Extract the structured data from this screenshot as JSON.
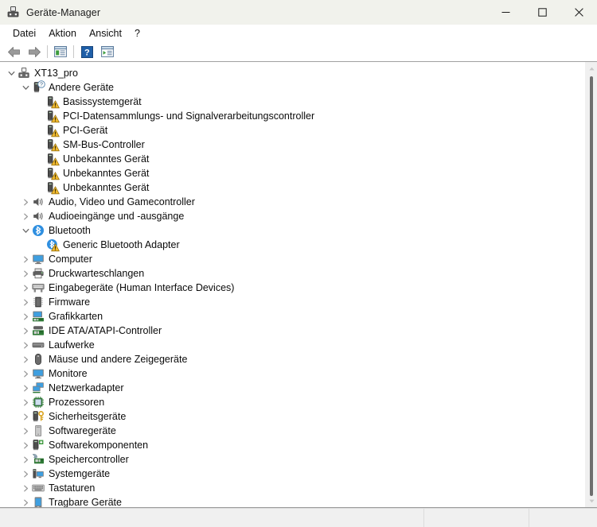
{
  "window": {
    "title": "Geräte-Manager",
    "icon": "device-manager-icon",
    "minimize_label": "—",
    "maximize_label": "□",
    "close_label": "✕"
  },
  "menubar": {
    "items": [
      {
        "label": "Datei",
        "name": "menu-datei"
      },
      {
        "label": "Aktion",
        "name": "menu-aktion"
      },
      {
        "label": "Ansicht",
        "name": "menu-ansicht"
      },
      {
        "label": "?",
        "name": "menu-hilfe"
      }
    ]
  },
  "toolbar": {
    "items": [
      {
        "icon": "back-arrow-icon",
        "tooltip": "Zurück"
      },
      {
        "icon": "forward-arrow-icon",
        "tooltip": "Vorwärts"
      },
      {
        "icon": "properties-icon",
        "tooltip": "Eigenschaften"
      },
      {
        "icon": "help-icon",
        "tooltip": "Hilfe"
      },
      {
        "icon": "scan-hardware-icon",
        "tooltip": "Nach geänderter Hardware suchen"
      }
    ]
  },
  "tree": {
    "rows": [
      {
        "depth": 0,
        "state": "expanded",
        "icon": "computer-root-icon",
        "label": "XT13_pro"
      },
      {
        "depth": 1,
        "state": "expanded",
        "icon": "unknown-device-group-icon",
        "label": "Andere Geräte"
      },
      {
        "depth": 2,
        "state": "leaf",
        "icon": "unknown-device-warning-icon",
        "label": "Basissystemgerät"
      },
      {
        "depth": 2,
        "state": "leaf",
        "icon": "unknown-device-warning-icon",
        "label": "PCI-Datensammlungs- und Signalverarbeitungscontroller"
      },
      {
        "depth": 2,
        "state": "leaf",
        "icon": "unknown-device-warning-icon",
        "label": "PCI-Gerät"
      },
      {
        "depth": 2,
        "state": "leaf",
        "icon": "unknown-device-warning-icon",
        "label": "SM-Bus-Controller"
      },
      {
        "depth": 2,
        "state": "leaf",
        "icon": "unknown-device-warning-icon",
        "label": "Unbekanntes Gerät"
      },
      {
        "depth": 2,
        "state": "leaf",
        "icon": "unknown-device-warning-icon",
        "label": "Unbekanntes Gerät"
      },
      {
        "depth": 2,
        "state": "leaf",
        "icon": "unknown-device-warning-icon",
        "label": "Unbekanntes Gerät"
      },
      {
        "depth": 1,
        "state": "collapsed",
        "icon": "speaker-icon",
        "label": "Audio, Video und Gamecontroller"
      },
      {
        "depth": 1,
        "state": "collapsed",
        "icon": "speaker-icon",
        "label": "Audioeingänge und -ausgänge"
      },
      {
        "depth": 1,
        "state": "expanded",
        "icon": "bluetooth-icon",
        "label": "Bluetooth"
      },
      {
        "depth": 2,
        "state": "leaf",
        "icon": "bluetooth-warning-icon",
        "label": "Generic Bluetooth Adapter"
      },
      {
        "depth": 1,
        "state": "collapsed",
        "icon": "monitor-icon",
        "label": "Computer"
      },
      {
        "depth": 1,
        "state": "collapsed",
        "icon": "printer-icon",
        "label": "Druckwarteschlangen"
      },
      {
        "depth": 1,
        "state": "collapsed",
        "icon": "hid-icon",
        "label": "Eingabegeräte (Human Interface Devices)"
      },
      {
        "depth": 1,
        "state": "collapsed",
        "icon": "firmware-chip-icon",
        "label": "Firmware"
      },
      {
        "depth": 1,
        "state": "collapsed",
        "icon": "display-adapter-icon",
        "label": "Grafikkarten"
      },
      {
        "depth": 1,
        "state": "collapsed",
        "icon": "ide-controller-icon",
        "label": "IDE ATA/ATAPI-Controller"
      },
      {
        "depth": 1,
        "state": "collapsed",
        "icon": "disk-drive-icon",
        "label": "Laufwerke"
      },
      {
        "depth": 1,
        "state": "collapsed",
        "icon": "mouse-icon",
        "label": "Mäuse und andere Zeigegeräte"
      },
      {
        "depth": 1,
        "state": "collapsed",
        "icon": "monitor-icon",
        "label": "Monitore"
      },
      {
        "depth": 1,
        "state": "collapsed",
        "icon": "network-adapter-icon",
        "label": "Netzwerkadapter"
      },
      {
        "depth": 1,
        "state": "collapsed",
        "icon": "processor-icon",
        "label": "Prozessoren"
      },
      {
        "depth": 1,
        "state": "collapsed",
        "icon": "security-device-icon",
        "label": "Sicherheitsgeräte"
      },
      {
        "depth": 1,
        "state": "collapsed",
        "icon": "software-device-icon",
        "label": "Softwaregeräte"
      },
      {
        "depth": 1,
        "state": "collapsed",
        "icon": "software-component-icon",
        "label": "Softwarekomponenten"
      },
      {
        "depth": 1,
        "state": "collapsed",
        "icon": "storage-controller-icon",
        "label": "Speichercontroller"
      },
      {
        "depth": 1,
        "state": "collapsed",
        "icon": "system-device-icon",
        "label": "Systemgeräte"
      },
      {
        "depth": 1,
        "state": "collapsed",
        "icon": "keyboard-icon",
        "label": "Tastaturen"
      },
      {
        "depth": 1,
        "state": "collapsed",
        "icon": "portable-device-icon",
        "label": "Tragbare Geräte"
      }
    ]
  },
  "statusbar": {
    "cells": [
      "",
      "",
      ""
    ]
  },
  "colors": {
    "titlebar": "#f1f2ec",
    "client": "#ffffff",
    "warning": "#f5bd31",
    "bluetooth": "#2f8fe0",
    "text": "#0b0b0b",
    "scrollbar_thumb": "#6e6e6e"
  }
}
